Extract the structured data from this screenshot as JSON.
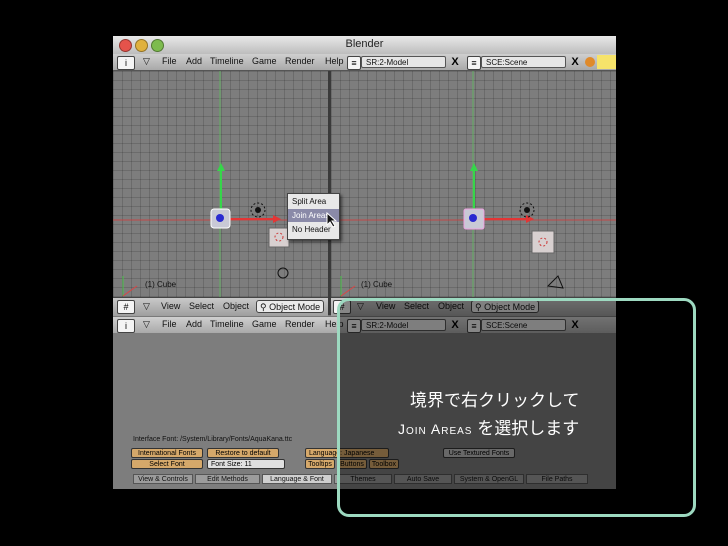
{
  "window": {
    "title": "Blender"
  },
  "top_left_menu": {
    "items": [
      "File",
      "Add",
      "Timeline",
      "Game",
      "Render",
      "Help"
    ],
    "screen": "SR:2-Model",
    "scene": "SCE:Scene",
    "close": "X"
  },
  "left_viewport": {
    "object_label": "(1) Cube"
  },
  "right_viewport": {
    "object_label": "(1) Cube"
  },
  "context_menu": {
    "items": [
      "Split Area",
      "Join Areas",
      "No Header"
    ],
    "highlighted": "Join Areas"
  },
  "view_header_left": {
    "view": "View",
    "select": "Select",
    "object": "Object",
    "mode": "Object Mode"
  },
  "view_header_right": {
    "view": "View",
    "select": "Select",
    "object": "Object",
    "mode": "Object Mode"
  },
  "bottom_menu": {
    "items": [
      "File",
      "Add",
      "Timeline",
      "Game",
      "Render",
      "Help"
    ],
    "screen": "SR:2-Model",
    "scene": "SCE:Scene",
    "close": "X"
  },
  "preferences": {
    "interface_font": "Interface Font: /System/Library/Fonts/AquaKana.ttc",
    "international_fonts": "International Fonts",
    "restore_default": "Restore to default",
    "select_font": "Select Font",
    "font_size": "Font Size: 11",
    "language": "Language: Japanese",
    "tooltips": "Tooltips",
    "buttons": "Buttons",
    "toolbox": "Toolbox",
    "textured_fonts": "Use Textured Fonts",
    "tabs": [
      "View & Controls",
      "Edit Methods",
      "Language & Font",
      "Themes",
      "Auto Save",
      "System & OpenGL",
      "File Paths"
    ],
    "active_tab": "Language & Font"
  },
  "caption": {
    "line1": "境界で右クリックして",
    "line2_prefix": "Join Areas",
    "line2_suffix": "を選択します"
  },
  "colors": {
    "highlight_border": "#9dd9c0",
    "viewport_bg": "#7d7d7d",
    "axis_x": "#d43c3c",
    "axis_y": "#5fbf5f",
    "active_button": "#d5a86a"
  }
}
